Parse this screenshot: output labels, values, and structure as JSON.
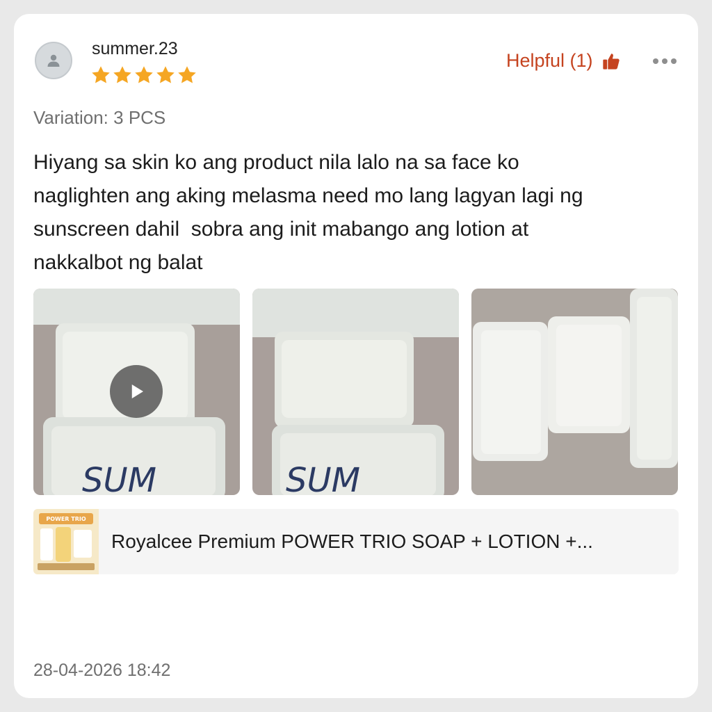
{
  "review": {
    "username": "summer.23",
    "rating": 5,
    "helpful_label": "Helpful (1)",
    "variation": "Variation: 3 PCS",
    "text": "Hiyang sa skin ko ang product nila lalo na sa face ko\nnaglighten ang aking melasma need mo lang lagyan lagi ng\nsunscreen dahil  sobra ang init mabango ang lotion at\nnakkalbot ng balat",
    "timestamp": "28-04-2026 18:42"
  },
  "media": [
    {
      "type": "video",
      "handwriting": "SUM"
    },
    {
      "type": "image",
      "handwriting": "SUM"
    },
    {
      "type": "image"
    }
  ],
  "product": {
    "title": "Royalcee Premium POWER TRIO SOAP + LOTION +...",
    "thumb_banner": "POWER TRIO"
  },
  "icons": {
    "avatar": "person-icon",
    "star": "star-icon",
    "helpful": "thumbs-up-icon",
    "more": "more-dots-icon",
    "play": "play-icon"
  },
  "colors": {
    "accent": "#c5431f",
    "star": "#f5a623",
    "text": "#1c1c1c",
    "muted": "#6f6f6f"
  }
}
